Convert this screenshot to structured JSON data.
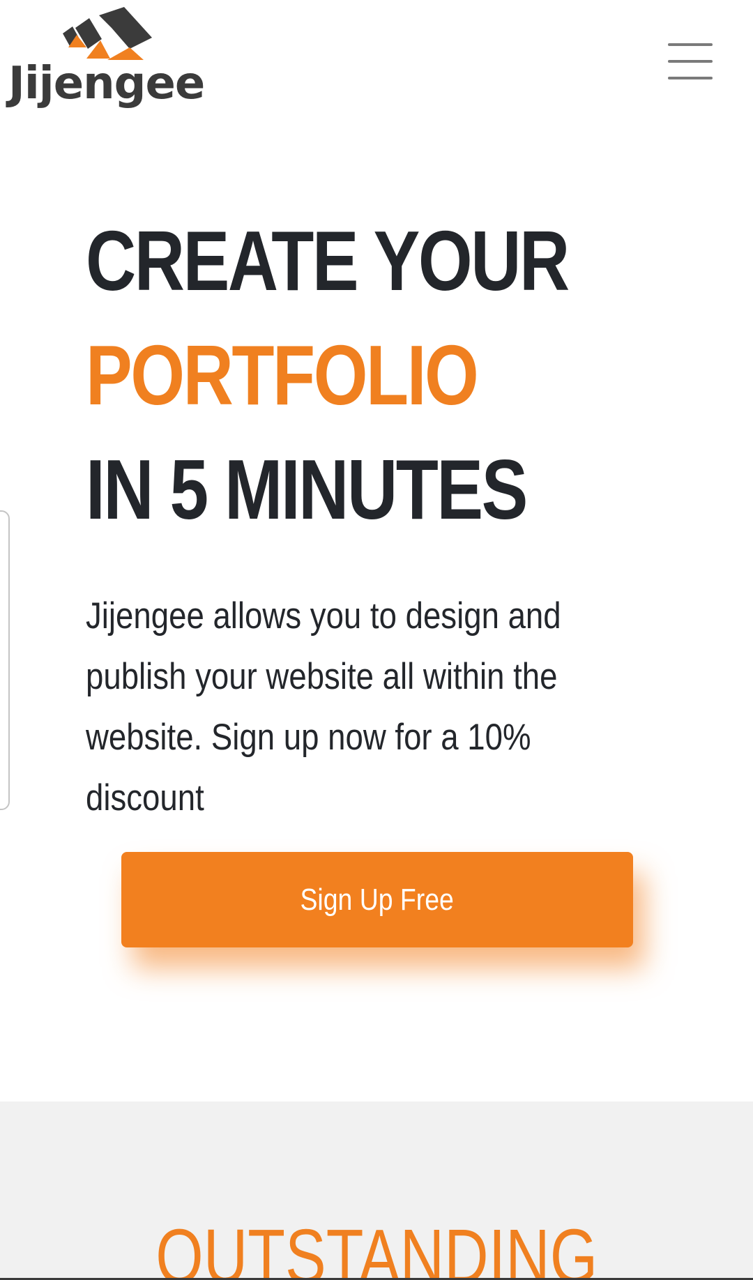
{
  "brand": {
    "name": "Jijengee",
    "accent_color": "#f08020",
    "dark_color": "#23262b"
  },
  "header": {
    "menu_icon": "hamburger-menu-icon"
  },
  "hero": {
    "title_line1": "CREATE YOUR",
    "title_line2": "PORTFOLIO",
    "title_line3": "IN 5 MINUTES",
    "description": "Jijengee allows you to design and publish your website all within the website. Sign up now for a 10% discount",
    "cta_label": "Sign Up Free"
  },
  "features": {
    "heading": "OUTSTANDING"
  }
}
